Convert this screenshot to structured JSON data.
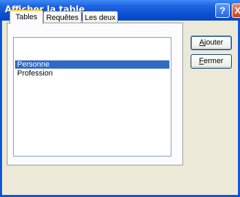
{
  "window": {
    "title": "Afficher la table",
    "help_glyph": "?",
    "close_glyph": "X"
  },
  "tabs": [
    {
      "label": "Tables",
      "active": true
    },
    {
      "label": "Requêtes",
      "active": false
    },
    {
      "label": "Les deux",
      "active": false
    }
  ],
  "list": {
    "items": [
      {
        "label": "Personne",
        "selected": true
      },
      {
        "label": "Profession",
        "selected": false
      }
    ]
  },
  "buttons": {
    "add": {
      "mnemonic": "A",
      "rest": "jouter"
    },
    "close": {
      "mnemonic": "F",
      "rest": "ermer"
    }
  },
  "colors": {
    "titlebar": "#0A4FD0",
    "selection": "#316AC5",
    "active_tab_accent": "#FFC83C",
    "dialog_bg": "#ECE9D8"
  }
}
